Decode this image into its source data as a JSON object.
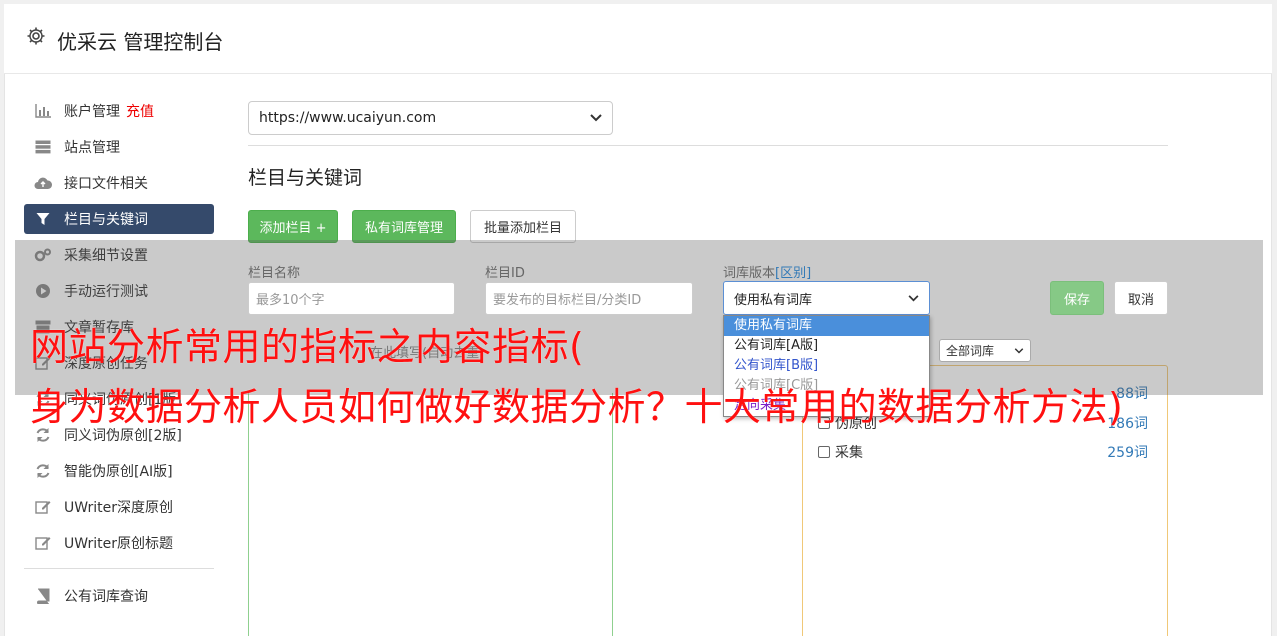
{
  "header": {
    "title": "优采云 管理控制台",
    "icon": "gear-icon"
  },
  "sidebar": {
    "items": [
      {
        "label": "账户管理",
        "icon": "bar-chart-icon",
        "badge": "充值"
      },
      {
        "label": "站点管理",
        "icon": "server-icon"
      },
      {
        "label": "接口文件相关",
        "icon": "cloud-upload-icon"
      },
      {
        "label": "栏目与关键词",
        "icon": "filter-icon",
        "active": true
      },
      {
        "label": "采集细节设置",
        "icon": "gears-icon"
      },
      {
        "label": "手动运行测试",
        "icon": "play-circle-icon"
      },
      {
        "label": "文章暂存库",
        "icon": "archive-icon"
      },
      {
        "label": "深度原创任务",
        "icon": "edit-icon"
      },
      {
        "label": "同义词伪原创[1版]",
        "icon": "refresh-icon"
      },
      {
        "label": "同义词伪原创[2版]",
        "icon": "refresh-icon"
      },
      {
        "label": "智能伪原创[AI版]",
        "icon": "refresh-icon"
      },
      {
        "label": "UWriter深度原创",
        "icon": "edit-icon"
      },
      {
        "label": "UWriter原创标题",
        "icon": "edit-icon"
      }
    ],
    "bottom_item": {
      "label": "公有词库查询",
      "icon": "book-icon"
    }
  },
  "site_select": {
    "value": "https://www.ucaiyun.com"
  },
  "section": {
    "title": "栏目与关键词"
  },
  "buttons": {
    "add_column": "添加栏目 +",
    "private_lib": "私有词库管理",
    "batch_add": "批量添加栏目",
    "save": "保存",
    "cancel": "取消"
  },
  "form": {
    "name_label": "栏目名称",
    "name_placeholder": "最多10个字",
    "id_label": "栏目ID",
    "id_placeholder": "要发布的目标栏目/分类ID",
    "version_label": "词库版本",
    "version_diff": "[区别]",
    "version_value": "使用私有词库",
    "version_options": [
      "使用私有词库",
      "公有词库[A版]",
      "公有词库[B版]",
      "公有词库[C版]",
      "定向采集"
    ]
  },
  "hint_text": "在此填写(自动去重)",
  "all_libs_select": "全部词库",
  "libraries": [
    {
      "label": "",
      "count": "88词"
    },
    {
      "label": "伪原创",
      "count": "186词"
    },
    {
      "label": "采集",
      "count": "259词"
    }
  ],
  "watermark": {
    "line1": "网站分析常用的指标之内容指标(",
    "line2": "身为数据分析人员如何做好数据分析？十大常用的数据分析方法)"
  },
  "colors": {
    "active_nav": "#354a6b",
    "green_button": "#5cb85c",
    "watermark": "#ff1010",
    "link_blue": "#337ab7"
  }
}
